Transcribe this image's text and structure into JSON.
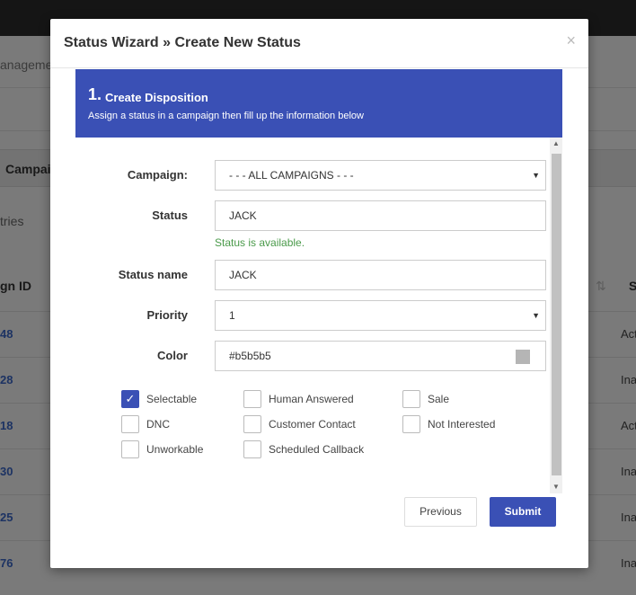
{
  "background": {
    "crumb": "anageme",
    "tab": "Campaig",
    "entries": "tries",
    "col_id": "gn ID",
    "col_status": "S",
    "rows": [
      {
        "id": "48",
        "status": "Act"
      },
      {
        "id": "28",
        "status": "Ina"
      },
      {
        "id": "18",
        "status": "Act"
      },
      {
        "id": "30",
        "status": "Ina"
      },
      {
        "id": "25",
        "status": "Ina"
      },
      {
        "id": "76",
        "status": "Ina"
      }
    ]
  },
  "modal": {
    "title": "Status Wizard » Create New Status",
    "close": "×",
    "step": {
      "number": "1.",
      "title": "Create Disposition",
      "description": "Assign a status in a campaign then fill up the information below"
    },
    "form": {
      "campaign_label": "Campaign:",
      "campaign_value": "- - - ALL CAMPAIGNS - - -",
      "status_label": "Status",
      "status_value": "JACK",
      "status_help": "Status is available.",
      "status_name_label": "Status name",
      "status_name_value": "JACK",
      "priority_label": "Priority",
      "priority_value": "1",
      "color_label": "Color",
      "color_value": "#b5b5b5"
    },
    "checkboxes": [
      {
        "label": "Selectable",
        "checked": true
      },
      {
        "label": "Human Answered",
        "checked": false
      },
      {
        "label": "Sale",
        "checked": false
      },
      {
        "label": "DNC",
        "checked": false
      },
      {
        "label": "Customer Contact",
        "checked": false
      },
      {
        "label": "Not Interested",
        "checked": false
      },
      {
        "label": "Unworkable",
        "checked": false
      },
      {
        "label": "Scheduled Callback",
        "checked": false
      }
    ],
    "buttons": {
      "previous": "Previous",
      "submit": "Submit"
    }
  },
  "colors": {
    "accent": "#3a50b5",
    "swatch": "#b5b5b5",
    "success_text": "#4a9a4a"
  }
}
